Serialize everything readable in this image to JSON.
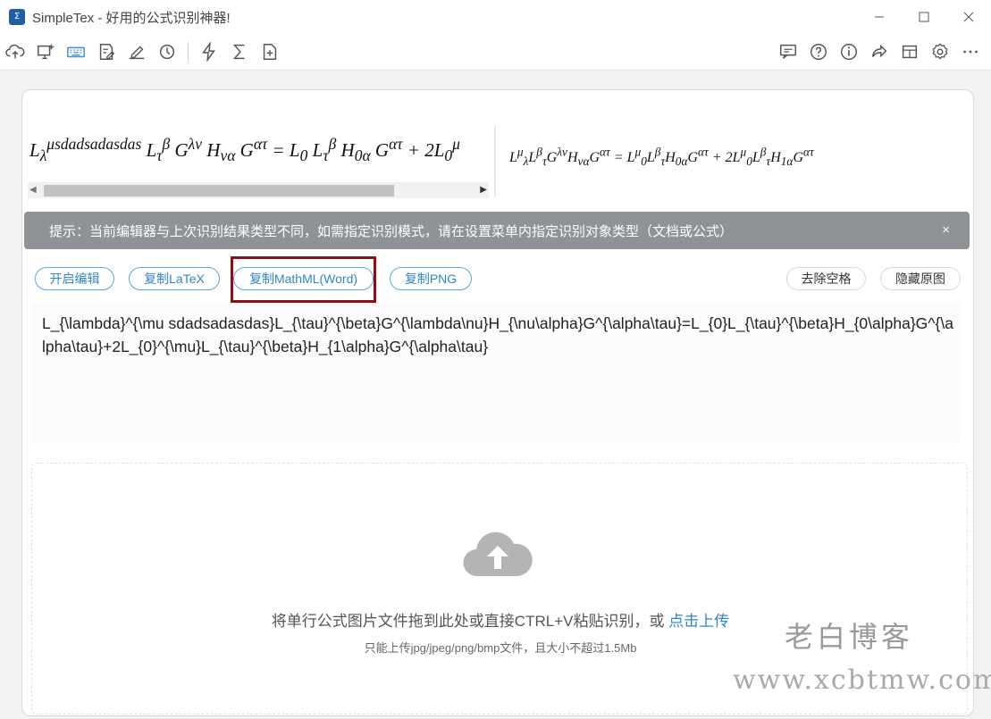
{
  "window": {
    "title": "SimpleTex - 好用的公式识别神器!",
    "logo_text": "Σ"
  },
  "toolbar": {
    "left_icons": [
      "cloud-upload-icon",
      "screen-capture-icon",
      "keyboard-icon",
      "edit-document-icon",
      "handwriting-icon",
      "history-icon",
      "lightning-icon",
      "sigma-icon",
      "add-file-icon"
    ],
    "right_icons": [
      "feedback-icon",
      "help-icon",
      "info-icon",
      "share-icon",
      "window-icon",
      "settings-icon",
      "more-icon"
    ]
  },
  "preview": {
    "left_formula": "L_{\\lambda}^{\\mu sdadsadasdas} L_{\\tau}^{\\beta} G^{\\lambda\\nu} H_{\\nu\\alpha} G^{\\alpha\\tau} = L_0 L_{\\tau}^{\\beta} H_{0\\alpha} G^{\\alpha\\tau} + 2L_0^{\\mu}",
    "right_formula": "L^{\\mu}_{\\lambda} L^{\\beta}_{\\tau} G^{\\lambda\\nu} H_{\\nu\\alpha} G^{\\alpha\\tau} = L^{\\mu}_0 L^{\\beta}_{\\tau} H_{0\\alpha} G^{\\alpha\\tau} + 2L^{\\mu}_0 L^{\\beta}_{\\tau} H_{1\\alpha} G^{\\alpha\\tau}"
  },
  "notice": {
    "text": "提示：当前编辑器与上次识别结果类型不同，如需指定识别模式，请在设置菜单内指定识别对象类型（文档或公式）",
    "close": "×"
  },
  "actions": {
    "open_editor": "开启编辑",
    "copy_latex": "复制LaTeX",
    "copy_mathml": "复制MathML(Word)",
    "copy_png": "复制PNG",
    "remove_spaces": "去除空格",
    "hide_original": "隐藏原图"
  },
  "latex_output": "L_{\\lambda}^{\\mu sdadsadasdas}L_{\\tau}^{\\beta}G^{\\lambda\\nu}H_{\\nu\\alpha}G^{\\alpha\\tau}=L_{0}L_{\\tau}^{\\beta}H_{0\\alpha}G^{\\alpha\\tau}+2L_{0}^{\\mu}L_{\\tau}^{\\beta}H_{1\\alpha}G^{\\alpha\\tau}",
  "upload": {
    "main_text": "将单行公式图片文件拖到此处或直接CTRL+V粘贴识别，或 ",
    "link_text": "点击上传",
    "hint": "只能上传jpg/jpeg/png/bmp文件，且大小不超过1.5Mb"
  },
  "watermark": {
    "name": "老白博客",
    "url": "www.xcbtmw.com"
  },
  "colors": {
    "accent": "#2f86cc",
    "highlight_border": "#8a1016",
    "notice_bg": "#8f9297"
  }
}
